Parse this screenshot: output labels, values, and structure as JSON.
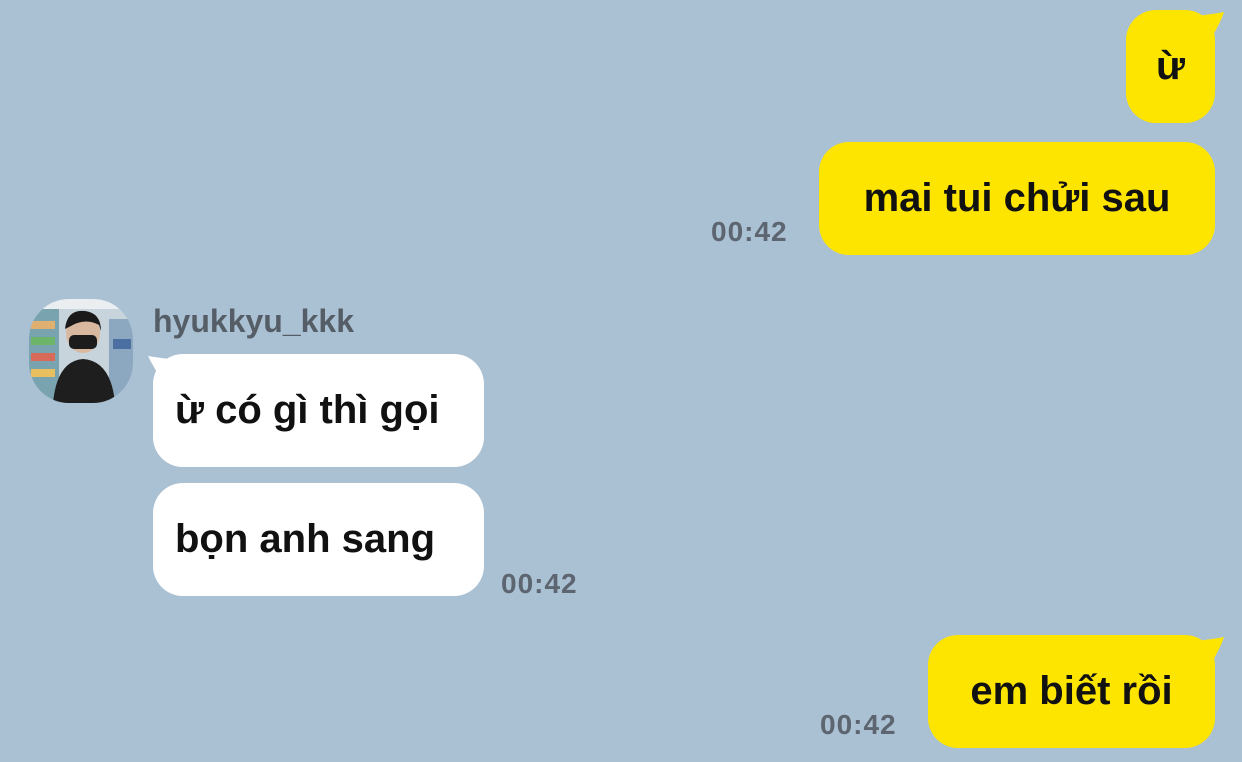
{
  "chat": {
    "background_color": "#aac0d3",
    "my_bubble_color": "#fee500",
    "their_bubble_color": "#ffffff",
    "messages": [
      {
        "side": "me",
        "text": "ừ"
      },
      {
        "side": "me",
        "text": "mai tui chửi sau",
        "time": "00:42"
      },
      {
        "side": "them",
        "sender": "hyukkyu_kkk",
        "text": "ừ có gì thì gọi"
      },
      {
        "side": "them",
        "text": "bọn anh sang",
        "time": "00:42"
      },
      {
        "side": "me",
        "text": "em biết rồi",
        "time": "00:42"
      }
    ]
  }
}
